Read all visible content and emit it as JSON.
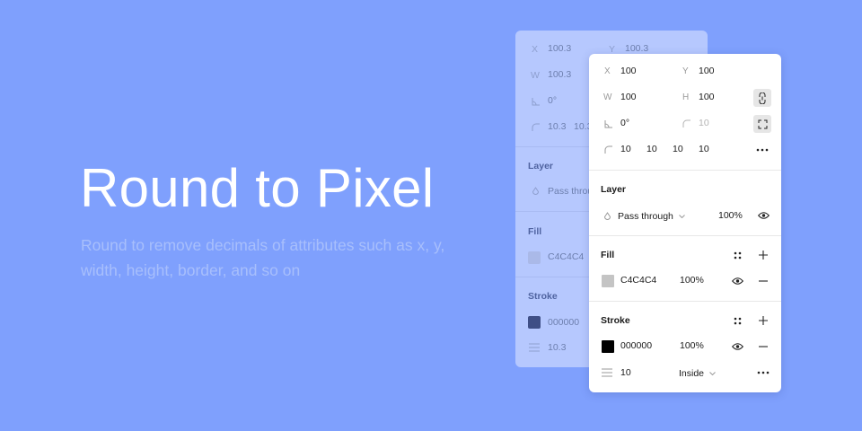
{
  "hero": {
    "title": "Round to Pixel",
    "subtitle": "Round to remove decimals of attributes such as x, y, width, height, border, and so on"
  },
  "back_panel": {
    "x_label": "X",
    "x_value": "100.3",
    "y_label": "Y",
    "y_value": "100.3",
    "w_label": "W",
    "w_value": "100.3",
    "rotation_value": "0°",
    "radius_a": "10.3",
    "radius_b": "10.3",
    "layer_title": "Layer",
    "blend_mode": "Pass throu",
    "fill_title": "Fill",
    "fill_color": "C4C4C4",
    "stroke_title": "Stroke",
    "stroke_color": "000000",
    "stroke_weight": "10.3",
    "colors": {
      "fill": "#aab9e8",
      "stroke": "#3f4f86"
    }
  },
  "panel": {
    "x_label": "X",
    "x_value": "100",
    "y_label": "Y",
    "y_value": "100",
    "w_label": "W",
    "w_value": "100",
    "h_label": "H",
    "h_value": "100",
    "rotation_value": "0°",
    "radius_value": "10",
    "corners": [
      "10",
      "10",
      "10",
      "10"
    ],
    "layer": {
      "title": "Layer",
      "blend_mode": "Pass through",
      "opacity": "100%"
    },
    "fill": {
      "title": "Fill",
      "color": "C4C4C4",
      "opacity": "100%"
    },
    "stroke": {
      "title": "Stroke",
      "color": "000000",
      "opacity": "100%",
      "weight": "10",
      "position": "Inside"
    },
    "icons": [
      "constrain-proportions-icon",
      "independent-corners-icon",
      "more-icon",
      "eye-icon",
      "style-grid-icon",
      "plus-icon",
      "minus-icon",
      "chevron-down-icon",
      "blend-drop-icon",
      "corner-radius-icon",
      "rotation-icon",
      "stroke-weight-icon"
    ],
    "colors": {
      "fill_swatch": "#c4c4c4",
      "stroke_swatch": "#000000",
      "background": "#7fa0fd"
    }
  }
}
